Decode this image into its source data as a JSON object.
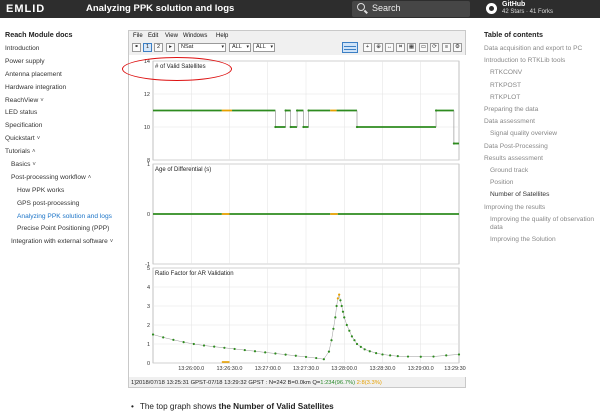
{
  "header": {
    "logo": "EMLID",
    "title": "Analyzing PPK solution and logs",
    "search_placeholder": "Search",
    "github": {
      "name": "GitHub",
      "stats": "42 Stars · 41 Forks"
    }
  },
  "left_nav": {
    "title": "Reach Module docs",
    "items": [
      {
        "label": "Introduction",
        "level": 0
      },
      {
        "label": "Power supply",
        "level": 0
      },
      {
        "label": "Antenna placement",
        "level": 0
      },
      {
        "label": "Hardware integration",
        "level": 0
      },
      {
        "label": "ReachView",
        "level": 0,
        "chevron": "˅"
      },
      {
        "label": "LED status",
        "level": 0
      },
      {
        "label": "Specification",
        "level": 0
      },
      {
        "label": "Quickstart",
        "level": 0,
        "chevron": "˅"
      },
      {
        "label": "Tutorials",
        "level": 0,
        "chevron": "˄"
      },
      {
        "label": "Basics",
        "level": 1,
        "chevron": "˅"
      },
      {
        "label": "Post-processing workflow",
        "level": 1,
        "chevron": "˄"
      },
      {
        "label": "How PPK works",
        "level": 2
      },
      {
        "label": "GPS post-processing",
        "level": 2
      },
      {
        "label": "Analyzing PPK solution and logs",
        "level": 2,
        "active": true
      },
      {
        "label": "Precise Point Positioning (PPP)",
        "level": 2
      },
      {
        "label": "Integration with external software",
        "level": 1,
        "chevron": "˅"
      }
    ]
  },
  "right_nav": {
    "title": "Table of contents",
    "items": [
      {
        "label": "Data acquisition and export to PC",
        "level": 0
      },
      {
        "label": "Introduction to RTKLib tools",
        "level": 0
      },
      {
        "label": "RTKCONV",
        "level": 1
      },
      {
        "label": "RTKPOST",
        "level": 1
      },
      {
        "label": "RTKPLOT",
        "level": 1
      },
      {
        "label": "Preparing the data",
        "level": 0
      },
      {
        "label": "Data assessment",
        "level": 0
      },
      {
        "label": "Signal quality overview",
        "level": 1
      },
      {
        "label": "Data Post-Processing",
        "level": 0
      },
      {
        "label": "Results assessment",
        "level": 0
      },
      {
        "label": "Ground track",
        "level": 1
      },
      {
        "label": "Position",
        "level": 1
      },
      {
        "label": "Number of Satellites",
        "level": 1,
        "current": true
      },
      {
        "label": "Improving the results",
        "level": 0
      },
      {
        "label": "Improving the quality of observation data",
        "level": 1
      },
      {
        "label": "Improving the Solution",
        "level": 1
      }
    ]
  },
  "app": {
    "menu": [
      "File",
      "Edit",
      "View",
      "Windows",
      "Help"
    ],
    "toolbar": {
      "buttons": [
        "1",
        "2"
      ],
      "plot_type": "NSat",
      "sel1": "ALL",
      "sel2": "ALL"
    },
    "status": {
      "main": "1]2018/07/18 13:25:31 GPST-07/18 13:29:32 GPST : N=242 B=0.0km Q=",
      "q1": "1:234(96.7%)",
      "q2": "2:8(3.3%)"
    }
  },
  "chart_data": {
    "type": "line",
    "x_ticks": [
      "13:26:00.0",
      "13:26:30.0",
      "13:27:00.0",
      "13:27:30.0",
      "13:28:00.0",
      "13:28:30.0",
      "13:29:00.0",
      "13:29:30"
    ],
    "panels": [
      {
        "title": "# of Valid Satellites",
        "ylim": [
          8,
          14
        ],
        "y_ticks": [
          14,
          12,
          10,
          8
        ],
        "series": [
          {
            "segments": [
              {
                "x": [
                  0,
                  54
                ],
                "y": 11
              },
              {
                "x": [
                  54,
                  62
                ],
                "y": 11,
                "color": "#e6a000"
              },
              {
                "x": [
                  62,
                  96
                ],
                "y": 11
              },
              {
                "x": [
                  96,
                  104
                ],
                "y": 10
              },
              {
                "x": [
                  104,
                  108
                ],
                "y": 11
              },
              {
                "x": [
                  108,
                  113
                ],
                "y": 10
              },
              {
                "x": [
                  113,
                  118
                ],
                "y": 11
              },
              {
                "x": [
                  118,
                  122
                ],
                "y": 10
              },
              {
                "x": [
                  122,
                  139
                ],
                "y": 11
              },
              {
                "x": [
                  139,
                  144
                ],
                "y": 11,
                "color": "#e6a000"
              },
              {
                "x": [
                  144,
                  160
                ],
                "y": 11
              },
              {
                "x": [
                  160,
                  200
                ],
                "y": 10
              },
              {
                "x": [
                  200,
                  222
                ],
                "y": 10
              },
              {
                "x": [
                  222,
                  236
                ],
                "y": 11
              },
              {
                "x": [
                  236,
                  240
                ],
                "y": 9
              }
            ]
          }
        ]
      },
      {
        "title": "Age of Differential (s)",
        "ylim": [
          -1,
          1
        ],
        "y_ticks": [
          1,
          0,
          -1
        ],
        "series": [
          {
            "segments": [
              {
                "x": [
                  0,
                  54
                ],
                "y": 0
              },
              {
                "x": [
                  54,
                  60
                ],
                "y": 0,
                "color": "#e6a000"
              },
              {
                "x": [
                  60,
                  139
                ],
                "y": 0
              },
              {
                "x": [
                  139,
                  145
                ],
                "y": 0,
                "color": "#e6a000"
              },
              {
                "x": [
                  145,
                  240
                ],
                "y": 0
              }
            ]
          }
        ]
      },
      {
        "title": "Ratio Factor for AR Validation",
        "ylim": [
          0,
          5
        ],
        "y_ticks": [
          5,
          4,
          3,
          2,
          1,
          0
        ],
        "series": [
          {
            "points": [
              [
                0,
                1.5
              ],
              [
                8,
                1.35
              ],
              [
                16,
                1.22
              ],
              [
                24,
                1.1
              ],
              [
                32,
                1.0
              ],
              [
                40,
                0.92
              ],
              [
                48,
                0.86
              ],
              [
                56,
                0.8
              ],
              [
                64,
                0.74
              ],
              [
                72,
                0.68
              ],
              [
                80,
                0.62
              ],
              [
                88,
                0.56
              ],
              [
                96,
                0.5
              ],
              [
                104,
                0.44
              ],
              [
                112,
                0.38
              ],
              [
                120,
                0.32
              ],
              [
                128,
                0.26
              ],
              [
                134,
                0.2
              ],
              [
                138,
                0.6
              ],
              [
                140,
                1.2
              ],
              [
                141.5,
                1.8
              ],
              [
                143,
                2.4
              ],
              [
                144,
                3.0
              ],
              [
                145,
                3.4
              ],
              [
                146,
                3.6
              ],
              [
                147,
                3.3
              ],
              [
                148,
                3.0
              ],
              [
                149,
                2.7
              ],
              [
                150,
                2.4
              ],
              [
                152,
                2.0
              ],
              [
                154,
                1.7
              ],
              [
                156,
                1.4
              ],
              [
                158,
                1.2
              ],
              [
                160,
                1.0
              ],
              [
                163,
                0.85
              ],
              [
                166,
                0.72
              ],
              [
                170,
                0.62
              ],
              [
                175,
                0.52
              ],
              [
                180,
                0.45
              ],
              [
                186,
                0.4
              ],
              [
                192,
                0.36
              ],
              [
                200,
                0.34
              ],
              [
                210,
                0.33
              ],
              [
                220,
                0.34
              ],
              [
                230,
                0.4
              ],
              [
                240,
                0.45
              ]
            ]
          }
        ]
      }
    ]
  },
  "annotation": {
    "note": "red ellipse highlighting # of Valid Satellites"
  },
  "bullet": {
    "prefix": "The top graph shows",
    "bold": "the Number of Valid Satellites"
  }
}
